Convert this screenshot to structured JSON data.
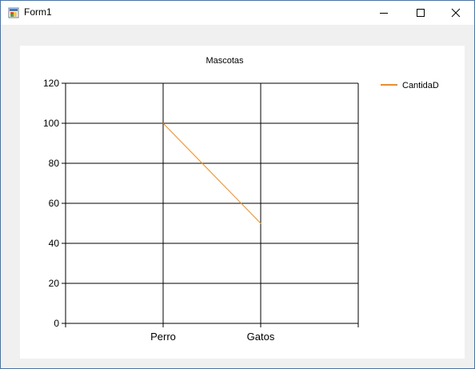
{
  "window": {
    "title": "Form1"
  },
  "chart_data": {
    "type": "line",
    "title": "Mascotas",
    "categories": [
      "Perro",
      "Gatos"
    ],
    "series": [
      {
        "name": "CantidaD",
        "values": [
          100,
          50
        ],
        "color": "#f28c1e"
      }
    ],
    "ylim": [
      0,
      120
    ],
    "yticks": [
      0,
      20,
      40,
      60,
      80,
      100,
      120
    ],
    "grid": true,
    "legend": "top-right"
  }
}
